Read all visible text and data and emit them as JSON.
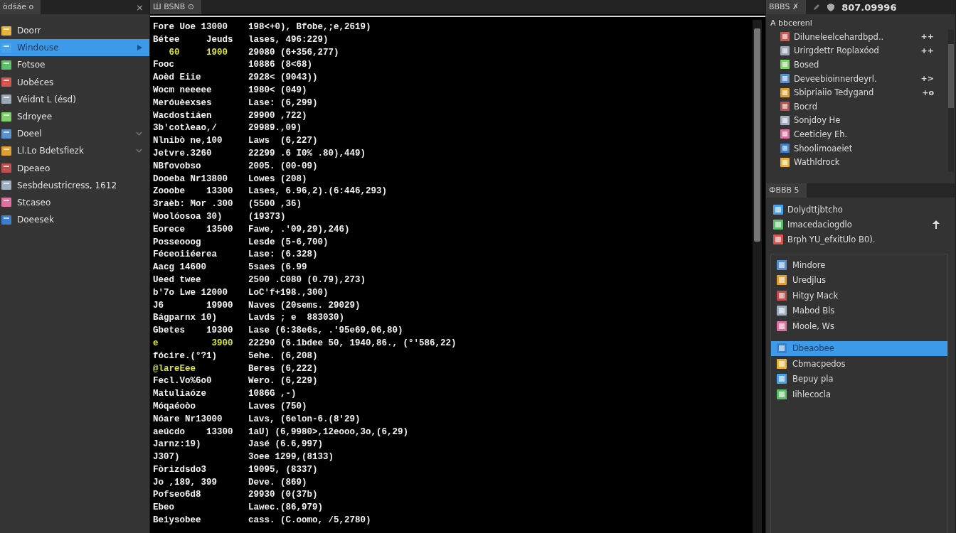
{
  "sidebar": {
    "tab": "ödšáe o",
    "close": "×",
    "items": [
      {
        "label": "Doorr",
        "selected": false,
        "expandable": false
      },
      {
        "label": "Windouse",
        "selected": true,
        "expandable": false
      },
      {
        "label": "Fotsoe",
        "selected": false,
        "expandable": false
      },
      {
        "label": "Uobéces",
        "selected": false,
        "expandable": false
      },
      {
        "label": "Véidnt L (ésd)",
        "selected": false,
        "expandable": false
      },
      {
        "label": "Sdroyee",
        "selected": false,
        "expandable": false
      },
      {
        "label": "Doeel",
        "selected": false,
        "expandable": true
      },
      {
        "label": "Ll.Lo Bdetsfiezk",
        "selected": false,
        "expandable": true
      },
      {
        "label": "Dpeaeo",
        "selected": false,
        "expandable": false
      },
      {
        "label": "Sesbdeustricress, 1612",
        "selected": false,
        "expandable": false
      },
      {
        "label": "Stcaseo",
        "selected": false,
        "expandable": false
      },
      {
        "label": "Doeesek",
        "selected": false,
        "expandable": false
      }
    ]
  },
  "editor": {
    "tab": "Ш BSNB ⊙",
    "lines": [
      {
        "col_1": "Fore Uoe 13000",
        "col_2": "198<+0), Bfobe,;e,2619)",
        "accent": false
      },
      {
        "col_1": "Bétee     Jeuds",
        "col_2": "lases, 496:229)",
        "accent": false
      },
      {
        "col_1": "   60     1900",
        "col_2": "29080 (6+356,277)",
        "accent": true
      },
      {
        "col_1": "Fooc",
        "col_2": "10886 (8<68)",
        "accent": false
      },
      {
        "col_1": "Aoèd Eiie",
        "col_2": "2928< (9043))",
        "accent": false
      },
      {
        "col_1": "Wocm neeeee",
        "col_2": "1980< (049)",
        "accent": false
      },
      {
        "col_1": "Meróuèexses",
        "col_2": "Lase: (6,299)",
        "accent": false
      },
      {
        "col_1": "Wacdostiáen",
        "col_2": "29900 ,722)",
        "accent": false
      },
      {
        "col_1": "3b'cotλeao,/",
        "col_2": "29989.,09)",
        "accent": false
      },
      {
        "col_1": "Nlnibò ne,100",
        "col_2": "Laws  (6,227)",
        "accent": false
      },
      {
        "col_1": "Jetvre.3260",
        "col_2": "22299 .6 I0% .80),449)",
        "accent": false
      },
      {
        "col_1": "NBfovobso",
        "col_2": "2005. (00-09)",
        "accent": false
      },
      {
        "col_1": "Dooeba Nr13800",
        "col_2": "Lowes (208)",
        "accent": false
      },
      {
        "col_1": "Zooobe    13300",
        "col_2": "Lases, 6.96,2).(6:446,293)",
        "accent": false
      },
      {
        "col_1": "3raèb: Mor .300",
        "col_2": "(5500 ,36)",
        "accent": false
      },
      {
        "col_1": "Woolóosoa 30)",
        "col_2": "(19373)",
        "accent": false
      },
      {
        "col_1": "Eorece    13500",
        "col_2": "Fawe, .'09,29),246)",
        "accent": false
      },
      {
        "col_1": "Posseooog",
        "col_2": "Lesde (5-6,700)",
        "accent": false
      },
      {
        "col_1": "Féceoiiéerea",
        "col_2": "Lase: (6.328)",
        "accent": false
      },
      {
        "col_1": "Aacg 14600",
        "col_2": "5saes (6.99",
        "accent": false
      },
      {
        "col_1": "Ueed twee",
        "col_2": "2500 .C080 (0.79),273)",
        "accent": false
      },
      {
        "col_1": "b'7o Lwe 12000",
        "col_2": "LoC'f+198.,300)",
        "accent": false
      },
      {
        "col_1": "J6        19900",
        "col_2": "Naves (20sems. 29029)",
        "accent": false
      },
      {
        "col_1": "Bágparnx 10)",
        "col_2": "Lavds ; e  883030)",
        "accent": false
      },
      {
        "col_1": "Gbetes    19300",
        "col_2": "Lase (6:38e6s, .'95e69,06,80)",
        "accent": false
      },
      {
        "col_1": "e          3900",
        "col_2": "22290 (6.1bdee 50, 1940,86., (°'586,22)",
        "accent": true
      },
      {
        "col_1": "fócire.(°?1)",
        "col_2": "5ehe. (6,208)",
        "accent": false
      },
      {
        "col_1": "@lareEee",
        "col_2": "Beres (6,222)",
        "accent": true
      },
      {
        "col_1": "Fecl.Vo%6o0",
        "col_2": "Wero. (6,229)",
        "accent": false
      },
      {
        "col_1": "Matuliaóze",
        "col_2": "1086G ,-)",
        "accent": false
      },
      {
        "col_1": "Móqaéoòo",
        "col_2": "Laves (750)",
        "accent": false
      },
      {
        "col_1": "Nóare Nr13000",
        "col_2": "Lavs, (6elon-6.(8'29)",
        "accent": false
      },
      {
        "col_1": "aeúcdo    13300",
        "col_2": "1aU) (6,9980>,12eooo,3o,(6,29)",
        "accent": false
      },
      {
        "col_1": "Jarnz:19)",
        "col_2": "Jasé (6.6,997)",
        "accent": false
      },
      {
        "col_1": "J307)",
        "col_2": "3oee 1299,(8133)",
        "accent": false
      },
      {
        "col_1": "Fòrizdsdo3",
        "col_2": "19095, (8337)",
        "accent": false
      },
      {
        "col_1": "Jo ,189, 399",
        "col_2": "Deve. (869)",
        "accent": false
      },
      {
        "col_1": "Pofseo6d8",
        "col_2": "29930 (0(37b)",
        "accent": false
      },
      {
        "col_1": "Ebeo",
        "col_2": "Lawec.(86,979)",
        "accent": false
      },
      {
        "col_1": "Beiysobee",
        "col_2": "cass. (C.oomo, /5,2780)",
        "accent": false
      }
    ]
  },
  "right": {
    "tab": "BBBS ✗",
    "toolbar_text": "807.09996",
    "panel_1": {
      "title": "A bbcerenl",
      "items": [
        {
          "label": "Diluneleelcehardbpd..",
          "badge": "++"
        },
        {
          "label": "Urirgdettr Roplaxóod",
          "badge": "++"
        },
        {
          "label": "Bosed"
        },
        {
          "label": "Deveebioinnerdeyrl.",
          "badge": "+>"
        },
        {
          "label": "Sbipriaiio Tedygand",
          "badge": "+o"
        },
        {
          "label": "Bocrd"
        },
        {
          "label": "Sonjdoy He"
        },
        {
          "label": "Ceeticiey Eh."
        },
        {
          "label": "Shoolimoaeiet"
        },
        {
          "label": "Wathldrock"
        }
      ]
    },
    "panel_2": {
      "tab": "ФBBB 5",
      "items": [
        {
          "label": "Dolydttjbtcho",
          "arrow": false
        },
        {
          "label": "Imacedaciogdlo",
          "arrow": true
        },
        {
          "label": "Brph YU_efxitUlo B0).",
          "arrow": false
        }
      ],
      "list": [
        {
          "label": "Mindore",
          "selected": false
        },
        {
          "label": "Uredjlus",
          "selected": false
        },
        {
          "label": "Hitgy Mack",
          "selected": false
        },
        {
          "label": "Mabod Bls",
          "selected": false
        },
        {
          "label": "Moole, Ws",
          "selected": false
        },
        {
          "label": "Dbeaobee",
          "selected": true
        },
        {
          "label": "Cbmacpedos",
          "selected": false
        },
        {
          "label": "Bepuy pla",
          "selected": false
        },
        {
          "label": "Iihlecocla",
          "selected": false
        }
      ]
    }
  }
}
